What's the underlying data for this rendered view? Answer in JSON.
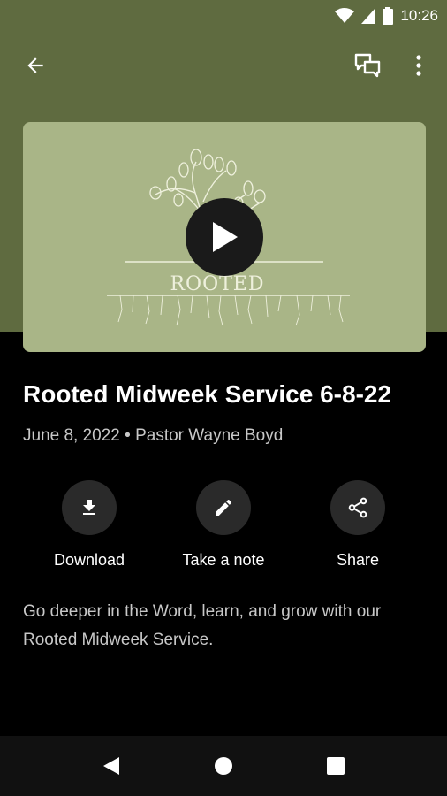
{
  "status_bar": {
    "time": "10:26"
  },
  "app_bar": {
    "back_icon": "arrow-back-icon",
    "chat_icon": "chat-bubbles-icon",
    "more_icon": "more-vert-icon"
  },
  "video": {
    "artwork_text": "ROOTED",
    "play_icon": "play-icon"
  },
  "content": {
    "title": "Rooted Midweek Service 6-8-22",
    "meta": "June 8, 2022 • Pastor Wayne Boyd",
    "description": "Go deeper in the Word, learn, and grow with our Rooted Midweek Service."
  },
  "actions": [
    {
      "label": "Download",
      "icon": "download-icon"
    },
    {
      "label": "Take a note",
      "icon": "pencil-icon"
    },
    {
      "label": "Share",
      "icon": "share-icon"
    }
  ],
  "nav_bar": {
    "back": "nav-back-icon",
    "home": "nav-home-icon",
    "recents": "nav-recents-icon"
  },
  "colors": {
    "header_bg": "#5f6b40",
    "card_bg": "#a9b587",
    "body_bg": "#000000"
  }
}
